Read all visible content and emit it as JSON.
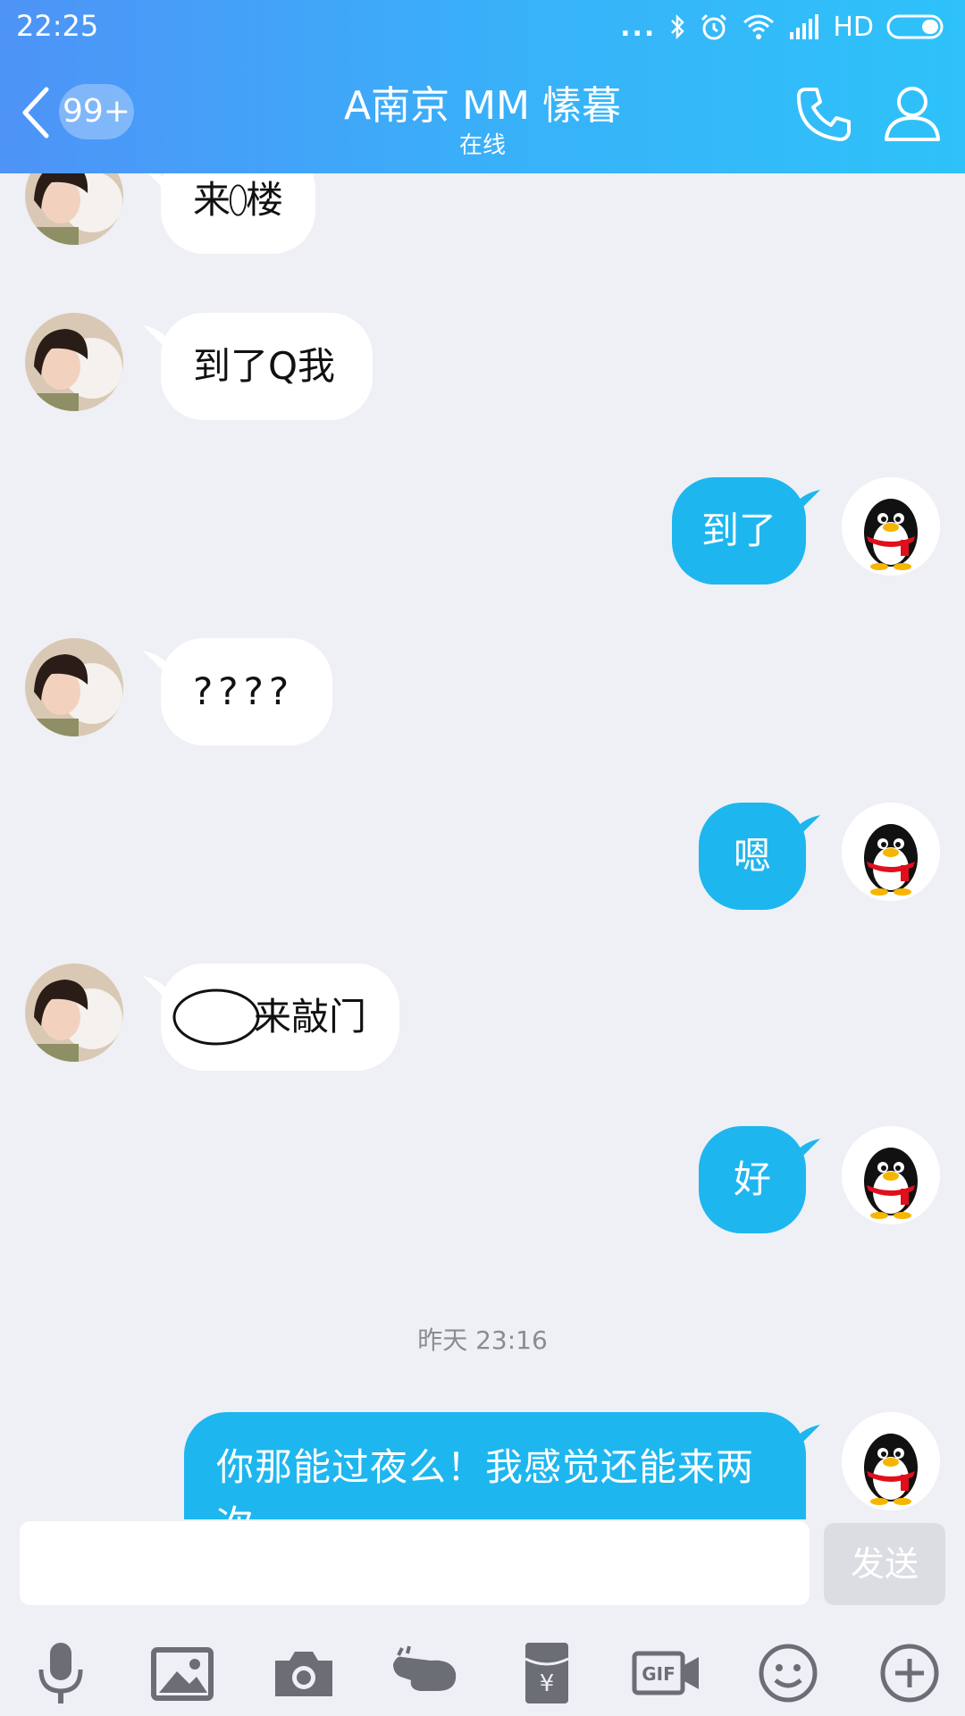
{
  "status_bar": {
    "time": "22:25",
    "dots": "...",
    "network": "HD"
  },
  "header": {
    "back_badge": "99+",
    "title": "A南京 MM 愫暮",
    "subtitle": "在线"
  },
  "messages": [
    {
      "side": "in",
      "text_a": "来",
      "text_b": "楼",
      "partial": true
    },
    {
      "side": "in",
      "text": "到了Q我"
    },
    {
      "side": "out",
      "text": "到了"
    },
    {
      "side": "in",
      "text": "????"
    },
    {
      "side": "out",
      "text": "嗯"
    },
    {
      "side": "in",
      "text": "来敲门"
    },
    {
      "side": "out",
      "text": "好"
    },
    {
      "side": "out",
      "text": "你那能过夜么！我感觉还能来两次",
      "partial": true
    }
  ],
  "time_separator": "昨天 23:16",
  "input": {
    "placeholder": "",
    "send_label": "发送"
  },
  "toolbar_icons": [
    "microphone-icon",
    "image-icon",
    "camera-icon",
    "poke-icon",
    "red-packet-icon",
    "gif-icon",
    "emoji-icon",
    "plus-icon"
  ],
  "colors": {
    "header_start": "#4e93f7",
    "header_end": "#2ec2f9",
    "bubble_out": "#1eb6ef",
    "background": "#eff0f5"
  }
}
